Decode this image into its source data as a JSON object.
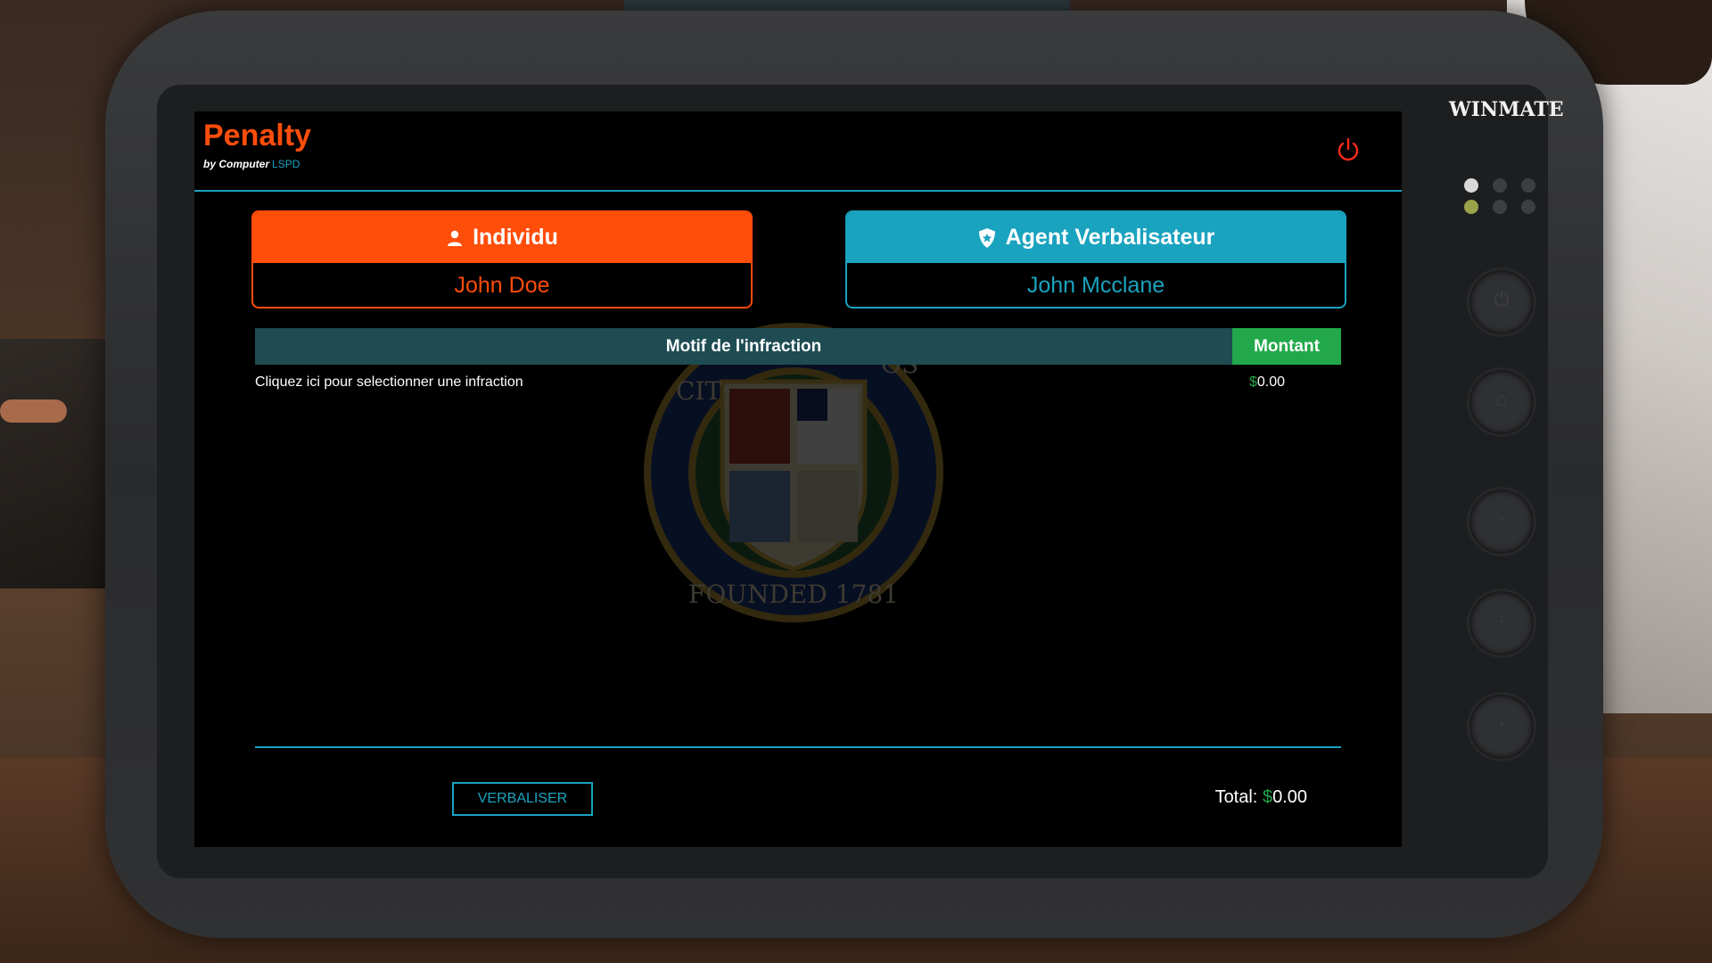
{
  "device": {
    "brand": "WINMATE"
  },
  "app": {
    "title": "Penalty",
    "subtitle_prefix": "by Computer",
    "subtitle_accent": "LSPD"
  },
  "cards": {
    "individual": {
      "header": "Individu",
      "value": "John Doe",
      "icon": "user-icon",
      "color": "#ff4d0a"
    },
    "officer": {
      "header": "Agent Verbalisateur",
      "value": "John Mcclane",
      "icon": "shield-icon",
      "color": "#1aa3bf"
    }
  },
  "table": {
    "col_reason": "Motif de l'infraction",
    "col_amount": "Montant",
    "row_placeholder": "Cliquez ici pour selectionner une infraction",
    "row_currency": "$",
    "row_amount": "0.00"
  },
  "seal": {
    "text_founded": "FOUNDED 1781",
    "text_partial_left": "CIT",
    "text_partial_right": "OS"
  },
  "footer": {
    "submit_label": "VERBALISER",
    "total_label": "Total:",
    "total_currency": "$",
    "total_value": "0.00"
  },
  "colors": {
    "accent_orange": "#ff4d0a",
    "accent_cyan": "#1aa3bf",
    "accent_green": "#22a84a",
    "header_teal": "#1e4c52"
  }
}
